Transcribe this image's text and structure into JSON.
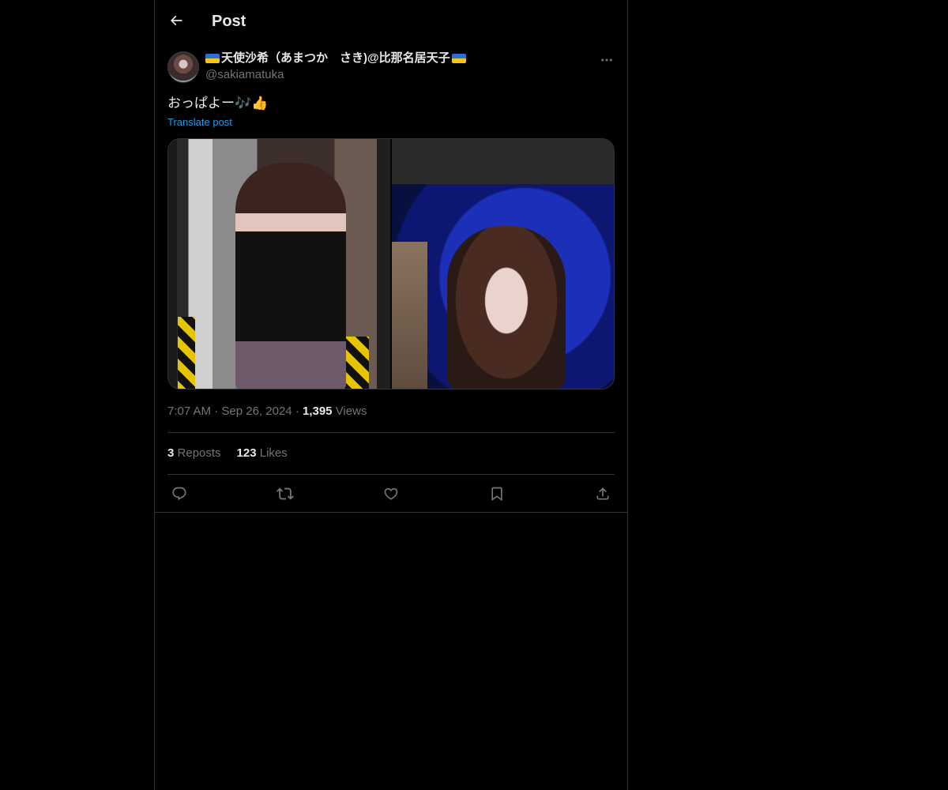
{
  "header": {
    "title": "Post",
    "back_icon": "arrow-left-icon"
  },
  "author": {
    "display_name": "天使沙希（あまつか　さき)@比那名居天子",
    "handle": "@sakiamatuka",
    "flag_icon": "ukraine-flag-icon"
  },
  "post": {
    "text": "おっぱよー🎶👍",
    "translate_label": "Translate post",
    "media_count": 2
  },
  "meta": {
    "time": "7:07 AM",
    "separator": "·",
    "date": "Sep 26, 2024",
    "views_count": "1,395",
    "views_label": "Views"
  },
  "stats": {
    "reposts_count": "3",
    "reposts_label": "Reposts",
    "likes_count": "123",
    "likes_label": "Likes"
  },
  "actions": [
    "reply-icon",
    "repost-icon",
    "like-icon",
    "bookmark-icon",
    "share-icon"
  ],
  "colors": {
    "background": "#000000",
    "text": "#e7e9ea",
    "secondary_text": "#71767b",
    "link": "#1d9bf0",
    "border": "#2f3336"
  }
}
